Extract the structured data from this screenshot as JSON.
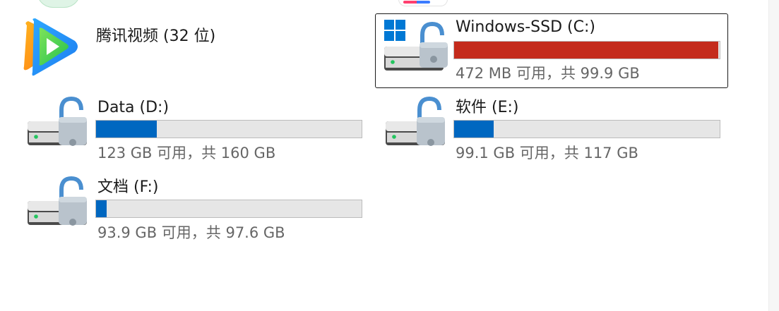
{
  "apps": [
    {
      "name": "腾讯视频 (32 位)",
      "icon": "tencent-video-icon"
    }
  ],
  "drives": [
    {
      "key": "c",
      "name": "Windows-SSD (C:)",
      "free_text": "472 MB 可用，共 99.9 GB",
      "used_fraction": 0.995,
      "status": "critical",
      "bar_color": "#c42b1c",
      "selected": true,
      "icon": "system-drive-icon"
    },
    {
      "key": "d",
      "name": "Data (D:)",
      "free_text": "123 GB 可用，共 160 GB",
      "used_fraction": 0.23,
      "status": "normal",
      "bar_color": "#0067c0",
      "selected": false,
      "icon": "locked-drive-icon"
    },
    {
      "key": "e",
      "name": "软件 (E:)",
      "free_text": "99.1 GB 可用，共 117 GB",
      "used_fraction": 0.15,
      "status": "normal",
      "bar_color": "#0067c0",
      "selected": false,
      "icon": "locked-drive-icon"
    },
    {
      "key": "f",
      "name": "文档 (F:)",
      "free_text": "93.9 GB 可用，共 97.6 GB",
      "used_fraction": 0.04,
      "status": "normal",
      "bar_color": "#0067c0",
      "selected": false,
      "icon": "locked-drive-icon"
    }
  ]
}
